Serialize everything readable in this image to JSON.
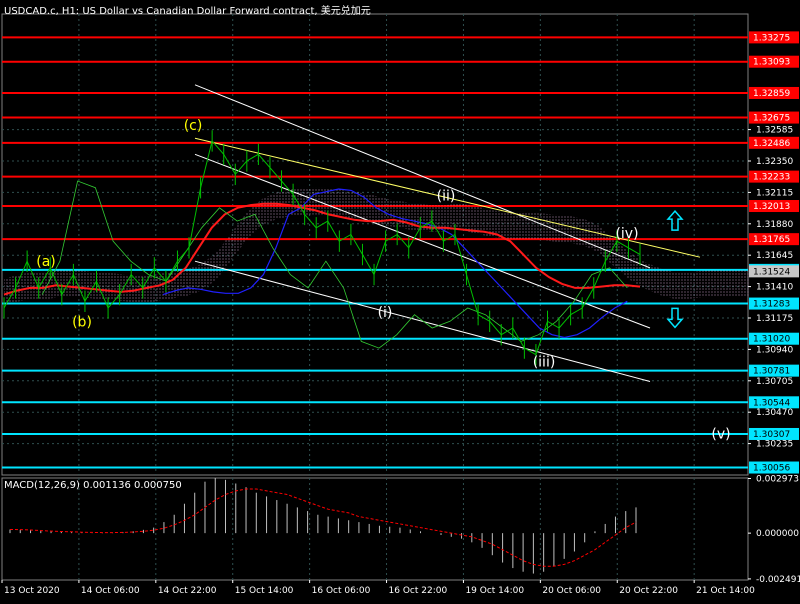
{
  "header": {
    "title": "USDCAD.c, H1:  US Dollar vs Canadian Dollar Forward contract, 美元兑加元"
  },
  "indicator": {
    "label": "MACD(12,26,9) 0.001136 0.000750"
  },
  "colors": {
    "background": "#000000",
    "grid": "#2f4f4f",
    "price": "#00c000",
    "resistance": "#ff0000",
    "support": "#00e5ff",
    "channel": "#ffffff",
    "trendline": "#ffff66",
    "ma_red": "#ff1a1a",
    "ma_blue": "#2020ff",
    "wave_label_yellow": "#ffff00",
    "wave_label_white": "#ffffff",
    "price_tag": "#c8c8c8",
    "macd_hist": "#c0c0c0",
    "macd_signal": "#ff0000",
    "arrow": "#00e5ff"
  },
  "chart_data": {
    "type": "line",
    "instrument": "USDCAD.c",
    "timeframe": "H1",
    "y_axis_labels": [
      "1.32585",
      "1.32350",
      "1.32115",
      "1.31880",
      "1.31645",
      "1.31410",
      "1.31175",
      "1.30940",
      "1.30705",
      "1.30470",
      "1.30235"
    ],
    "ylim": [
      1.3,
      1.3345
    ],
    "x_axis_labels": [
      "13 Oct 2020",
      "14 Oct 06:00",
      "14 Oct 22:00",
      "15 Oct 14:00",
      "16 Oct 06:00",
      "16 Oct 22:00",
      "19 Oct 14:00",
      "20 Oct 06:00",
      "20 Oct 22:00",
      "21 Oct 14:00"
    ],
    "current_price": "1.31524",
    "resistance_levels": [
      "1.33275",
      "1.33093",
      "1.32859",
      "1.32675",
      "1.32486",
      "1.32233",
      "1.32013",
      "1.31765"
    ],
    "support_levels": [
      "1.31535",
      "1.31283",
      "1.31020",
      "1.30781",
      "1.30544",
      "1.30307",
      "1.30056"
    ],
    "wave_labels": [
      "(a)",
      "(b)",
      "(c)",
      "(i)",
      "(ii)",
      "(iii)",
      "(iv)",
      "(v)"
    ],
    "series": [
      {
        "values": [
          1.3125,
          1.314,
          1.316,
          1.314,
          1.3155,
          1.3135,
          1.315,
          1.313,
          1.3145,
          1.3125,
          1.3135,
          1.315,
          1.314,
          1.3155,
          1.3145,
          1.316,
          1.317,
          1.3215,
          1.325,
          1.324,
          1.3225,
          1.3235,
          1.324,
          1.323,
          1.322,
          1.321,
          1.3195,
          1.3185,
          1.319,
          1.3175,
          1.318,
          1.3165,
          1.315,
          1.3175,
          1.318,
          1.317,
          1.3185,
          1.319,
          1.3175,
          1.318,
          1.315,
          1.312,
          1.3115,
          1.3105,
          1.311,
          1.3095,
          1.309,
          1.3115,
          1.311,
          1.312,
          1.3125,
          1.314,
          1.316,
          1.3175,
          1.317,
          1.3165
        ]
      },
      {
        "values": [
          1.3135,
          1.3138,
          1.314,
          1.314,
          1.3142,
          1.3141,
          1.314,
          1.3139,
          1.3138,
          1.3137,
          1.3138,
          1.314,
          1.3142,
          1.3146,
          1.3155,
          1.317,
          1.3185,
          1.3195,
          1.32,
          1.3202,
          1.3203,
          1.3203,
          1.3202,
          1.32,
          1.3198,
          1.3195,
          1.3193,
          1.3191,
          1.319,
          1.319,
          1.3191,
          1.3189,
          1.3186,
          1.3185,
          1.3185,
          1.3184,
          1.3183,
          1.3182,
          1.318,
          1.3175,
          1.3165,
          1.3155,
          1.3148,
          1.3143,
          1.314,
          1.314,
          1.3141,
          1.3142,
          1.3142,
          1.3141
        ]
      },
      {
        "values": [
          1.3135,
          1.3138,
          1.314,
          1.3139,
          1.3137,
          1.3136,
          1.3136,
          1.314,
          1.315,
          1.317,
          1.3195,
          1.32,
          1.321,
          1.3212,
          1.3214,
          1.3213,
          1.3208,
          1.32,
          1.3195,
          1.3192,
          1.319,
          1.3188,
          1.3185,
          1.318,
          1.317,
          1.316,
          1.315,
          1.314,
          1.313,
          1.312,
          1.311,
          1.3105,
          1.3103,
          1.3105,
          1.311,
          1.3118,
          1.3125,
          1.313
        ]
      },
      {
        "values": [
          1.3135,
          1.316,
          1.322,
          1.3215,
          1.3175,
          1.316,
          1.315,
          1.3145,
          1.3165,
          1.3185,
          1.32,
          1.319,
          1.3195,
          1.317,
          1.315,
          1.314,
          1.316,
          1.314,
          1.31,
          1.3095,
          1.3105,
          1.312,
          1.311,
          1.3115,
          1.3125,
          1.312,
          1.311,
          1.31,
          1.3105,
          1.3115,
          1.313,
          1.315,
          1.3155,
          1.314
        ]
      }
    ],
    "macd": {
      "labels": [
        "0.002973",
        "0.000000",
        "-0.002491"
      ],
      "ylim": [
        -0.00255,
        0.003
      ],
      "histogram": [
        0.0002,
        0.00018,
        0.00015,
        0.00012,
        0.0001,
        8e-05,
        5e-05,
        3e-05,
        1e-05,
        -1e-05,
        2e-05,
        5e-05,
        0.0001,
        0.00018,
        0.0003,
        0.0006,
        0.001,
        0.0016,
        0.0022,
        0.0028,
        0.003,
        0.0029,
        0.0027,
        0.0025,
        0.0022,
        0.002,
        0.0018,
        0.0016,
        0.0014,
        0.0012,
        0.001,
        0.0009,
        0.0008,
        0.0007,
        0.0006,
        0.0005,
        0.0004,
        0.00035,
        0.0003,
        0.0002,
        0.0001,
        0.0,
        -0.0001,
        -0.0002,
        -0.0003,
        -0.0005,
        -0.0008,
        -0.0012,
        -0.0016,
        -0.0019,
        -0.0021,
        -0.0022,
        -0.0021,
        -0.0018,
        -0.0014,
        -0.001,
        -0.0005,
        0.0001,
        0.0005,
        0.0009,
        0.0012,
        0.0014
      ],
      "signal": [
        0.0002,
        0.00019,
        0.00017,
        0.00014,
        0.00011,
        9e-05,
        7e-05,
        5e-05,
        4e-05,
        3e-05,
        3e-05,
        4e-05,
        6e-05,
        0.0001,
        0.00016,
        0.00027,
        0.00045,
        0.0007,
        0.001,
        0.0014,
        0.0018,
        0.0021,
        0.0023,
        0.0024,
        0.0024,
        0.0023,
        0.0022,
        0.0021,
        0.0019,
        0.0017,
        0.0015,
        0.0013,
        0.0012,
        0.0011,
        0.0009,
        0.0008,
        0.0007,
        0.0006,
        0.0005,
        0.0004,
        0.0003,
        0.0002,
        0.0001,
        0.0,
        -0.0001,
        -0.0002,
        -0.0004,
        -0.0006,
        -0.0009,
        -0.0012,
        -0.0015,
        -0.0017,
        -0.0018,
        -0.0018,
        -0.0017,
        -0.0015,
        -0.0012,
        -0.0009,
        -0.0005,
        -0.0001,
        0.0003,
        0.0006
      ]
    }
  }
}
